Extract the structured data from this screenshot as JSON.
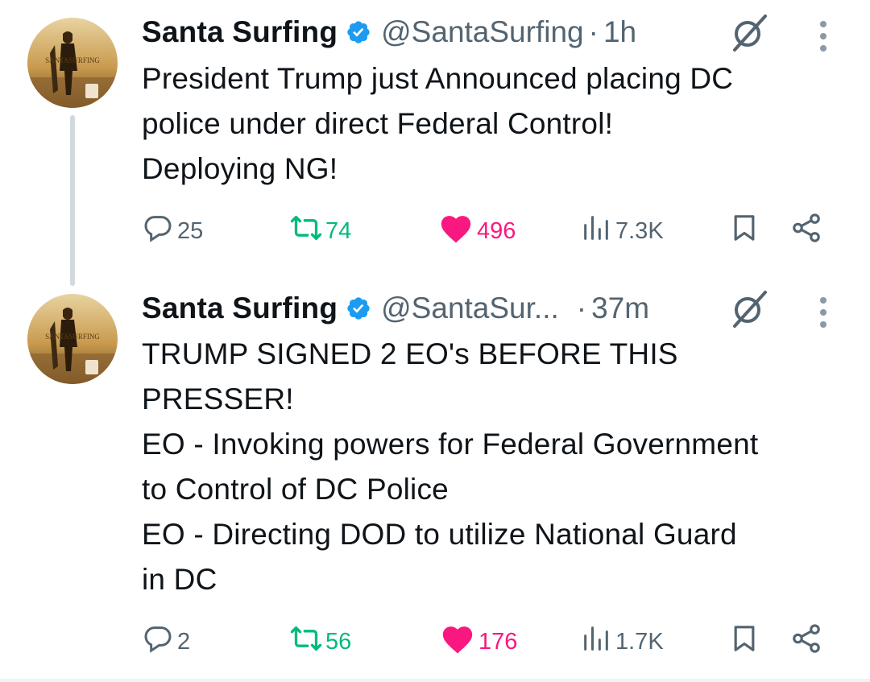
{
  "tweets": [
    {
      "author": "Santa Surfing",
      "handle": "@SantaSurfing",
      "separator": "·",
      "time": "1h",
      "text": "President Trump just Announced placing DC\npolice under direct Federal Control!\nDeploying NG!",
      "replies": "25",
      "retweets": "74",
      "likes": "496",
      "views": "7.3K",
      "avatar_text": "SANTASURFING"
    },
    {
      "author": "Santa Surfing",
      "handle": "@SantaSur...",
      "separator": "·",
      "time": "37m",
      "text": "TRUMP SIGNED 2 EO's BEFORE THIS\nPRESSER!\nEO - Invoking powers for Federal Government\nto Control of DC Police\nEO - Directing DOD to utilize National Guard\nin DC",
      "replies": "2",
      "retweets": "56",
      "likes": "176",
      "views": "1.7K",
      "avatar_text": "SANTASURFING"
    }
  ],
  "colors": {
    "text": "#0f1419",
    "secondary": "#536471",
    "verified": "#1d9bf0",
    "retweet": "#00ba7c",
    "like": "#f91880",
    "thread_line": "#cfd9de"
  },
  "icons": [
    "reply-icon",
    "retweet-icon",
    "like-icon",
    "views-icon",
    "bookmark-icon",
    "share-icon",
    "grok-icon",
    "more-icon",
    "verified-badge-icon"
  ]
}
